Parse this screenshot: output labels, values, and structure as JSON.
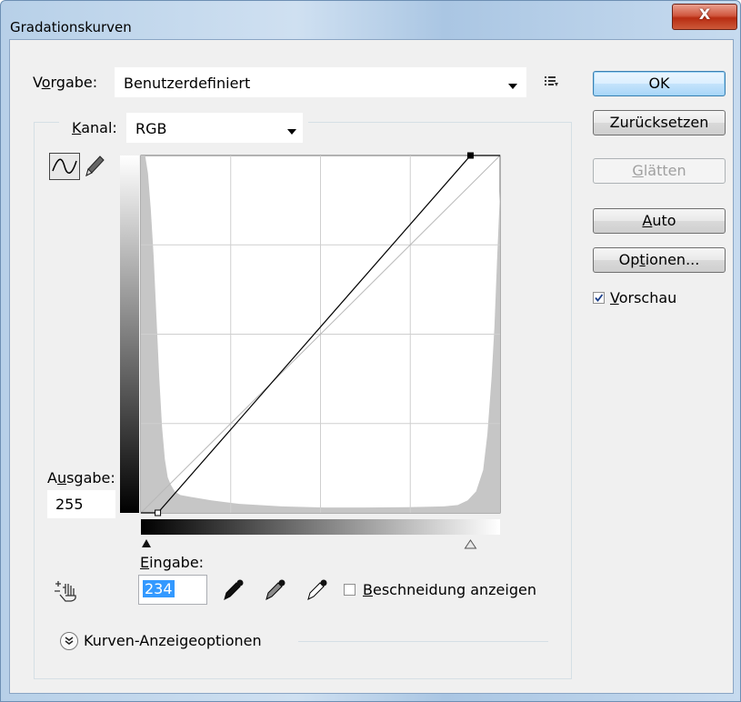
{
  "window": {
    "title": "Gradationskurven",
    "close_glyph": "X"
  },
  "preset": {
    "label_pre": "V",
    "label_ul": "o",
    "label_post": "rgabe:",
    "value": "Benutzerdefiniert",
    "menu_icon": "preset-list-icon"
  },
  "channel": {
    "label_ul": "K",
    "label_post": "anal:",
    "value": "RGB"
  },
  "buttons": {
    "ok": "OK",
    "reset": "Zurücksetzen",
    "smooth_ul": "G",
    "smooth_post": "lätten",
    "auto_ul": "A",
    "auto_post": "uto",
    "options_pre": "Op",
    "options_ul": "t",
    "options_post": "ionen..."
  },
  "preview": {
    "label_ul": "V",
    "label_post": "orschau",
    "checked": true
  },
  "output": {
    "label_pre": "A",
    "label_ul": "u",
    "label_post": "sgabe:",
    "value": "255"
  },
  "input": {
    "label_ul": "E",
    "label_post": "ingabe:",
    "value": "234"
  },
  "clipping": {
    "label_ul": "B",
    "label_post": "eschneidung anzeigen",
    "checked": false
  },
  "display_options": {
    "label": "Kurven-Anzeigeoptionen"
  },
  "icons": [
    "curve-tool-icon",
    "pencil-tool-icon",
    "hand-adjust-icon",
    "black-eyedropper-icon",
    "gray-eyedropper-icon",
    "white-eyedropper-icon",
    "expand-chevron-icon"
  ],
  "colors": {
    "ok_border": "#3c7fb1",
    "close_red": "#c9462d",
    "selection": "#3399ff"
  },
  "chart_data": {
    "type": "line",
    "x_range": [
      0,
      255
    ],
    "y_range": [
      0,
      255
    ],
    "grid": "4x4",
    "series": [
      {
        "x": [
          0,
          12,
          234,
          255
        ],
        "y": [
          0,
          0,
          255,
          255
        ]
      }
    ],
    "histogram": [
      [
        0,
        1.0
      ],
      [
        3,
        1.0
      ],
      [
        5,
        0.95
      ],
      [
        7,
        0.85
      ],
      [
        9,
        0.72
      ],
      [
        11,
        0.55
      ],
      [
        13,
        0.38
      ],
      [
        15,
        0.24
      ],
      [
        17,
        0.15
      ],
      [
        19,
        0.1
      ],
      [
        21,
        0.08
      ],
      [
        24,
        0.06
      ],
      [
        28,
        0.05
      ],
      [
        35,
        0.045
      ],
      [
        50,
        0.035
      ],
      [
        70,
        0.025
      ],
      [
        100,
        0.018
      ],
      [
        130,
        0.015
      ],
      [
        160,
        0.015
      ],
      [
        190,
        0.016
      ],
      [
        215,
        0.018
      ],
      [
        225,
        0.022
      ],
      [
        232,
        0.035
      ],
      [
        238,
        0.06
      ],
      [
        243,
        0.12
      ],
      [
        246,
        0.22
      ],
      [
        249,
        0.38
      ],
      [
        251,
        0.52
      ],
      [
        253,
        0.72
      ],
      [
        255,
        0.9
      ]
    ],
    "input_black_slider": 0,
    "input_white_slider": 234
  }
}
